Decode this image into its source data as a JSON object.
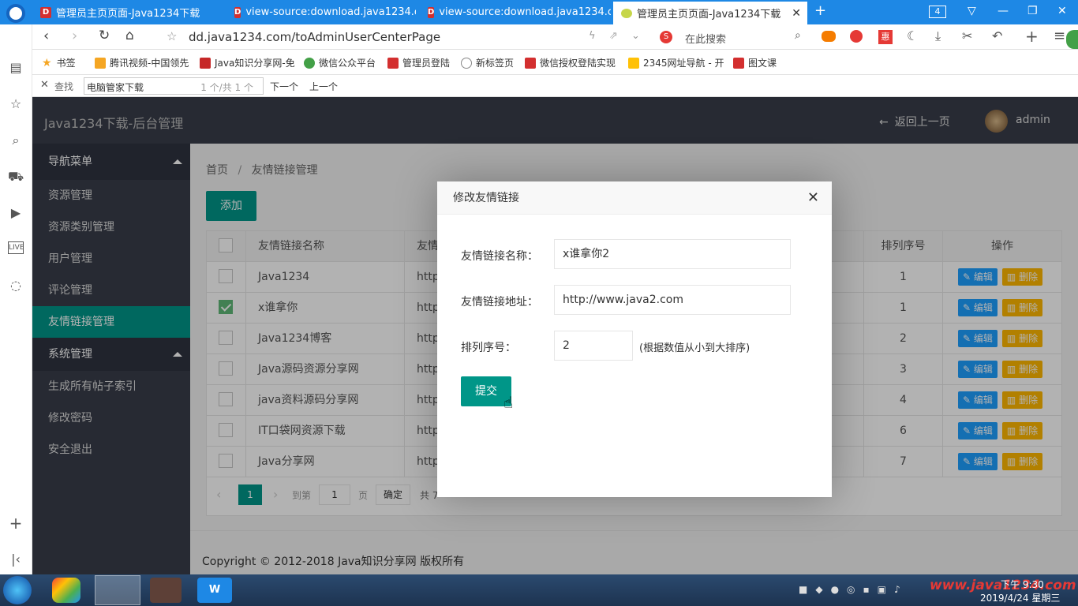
{
  "browser": {
    "tabs": [
      {
        "title": "管理员主页页面-Java1234下载",
        "active": false,
        "favicon": "D"
      },
      {
        "title": "view-source:download.java1234.co",
        "active": false,
        "favicon": "D"
      },
      {
        "title": "view-source:download.java1234.co",
        "active": false,
        "favicon": "D"
      },
      {
        "title": "管理员主页页面-Java1234下载",
        "active": true,
        "favicon": "leaf"
      }
    ],
    "tab_count": "4",
    "url": "dd.java1234.com/toAdminUserCenterPage",
    "search_placeholder": "在此搜索",
    "bookmarks": [
      "书签",
      "腾讯视频-中国领先",
      "Java知识分享网-免",
      "微信公众平台",
      "管理员登陆",
      "新标签页",
      "微信授权登陆实现",
      "2345网址导航 - 开",
      "图文课"
    ],
    "find": {
      "label": "查找",
      "value": "电脑管家下载",
      "count": "1 个/共 1 个",
      "next": "下一个",
      "prev": "上一个"
    }
  },
  "app": {
    "title": "Java1234下载-后台管理",
    "back_link": "返回上一页",
    "user": "admin",
    "sidebar": {
      "group1": "导航菜单",
      "items1": [
        "资源管理",
        "资源类别管理",
        "用户管理",
        "评论管理",
        "友情链接管理"
      ],
      "group2": "系统管理",
      "items2": [
        "生成所有帖子索引",
        "修改密码",
        "安全退出"
      ]
    },
    "breadcrumb": {
      "home": "首页",
      "sep": "/",
      "current": "友情链接管理"
    },
    "add_button": "添加",
    "table": {
      "headers": {
        "name": "友情链接名称",
        "url": "友情",
        "order": "排列序号",
        "ops": "操作"
      },
      "rows": [
        {
          "checked": false,
          "name": "Java1234",
          "url": "http:",
          "order": "1"
        },
        {
          "checked": true,
          "name": "x谁拿你",
          "url": "http:",
          "order": "1"
        },
        {
          "checked": false,
          "name": "Java1234博客",
          "url": "http:",
          "order": "2"
        },
        {
          "checked": false,
          "name": "Java源码资源分享网",
          "url": "http:",
          "order": "3"
        },
        {
          "checked": false,
          "name": "java资料源码分享网",
          "url": "http:",
          "order": "4"
        },
        {
          "checked": false,
          "name": "IT口袋网资源下载",
          "url": "http:",
          "order": "6"
        },
        {
          "checked": false,
          "name": "Java分享网",
          "url": "http:",
          "order": "7"
        }
      ],
      "edit_label": "编辑",
      "delete_label": "删除"
    },
    "pager": {
      "page": "1",
      "goto": "到第",
      "page_input": "1",
      "page_unit": "页",
      "confirm": "确定",
      "total": "共 7"
    },
    "footer": "Copyright © 2012-2018 Java知识分享网 版权所有"
  },
  "dialog": {
    "title": "修改友情链接",
    "name_label": "友情链接名称：",
    "name_value": "x谁拿你2",
    "url_label": "友情链接地址：",
    "url_value": "http://www.java2.com",
    "order_label": "排列序号：",
    "order_value": "2",
    "order_hint": "(根据数值从小到大排序)",
    "submit": "提交"
  },
  "taskbar": {
    "watermark": "www.java1234.com",
    "time": "下午 9:30",
    "date": "2019/4/24 星期三"
  },
  "colors": {
    "accent": "#009688",
    "sidebar": "#393d49",
    "tabbar": "#1e88e5",
    "edit": "#1e9fff",
    "delete": "#ffb800"
  }
}
